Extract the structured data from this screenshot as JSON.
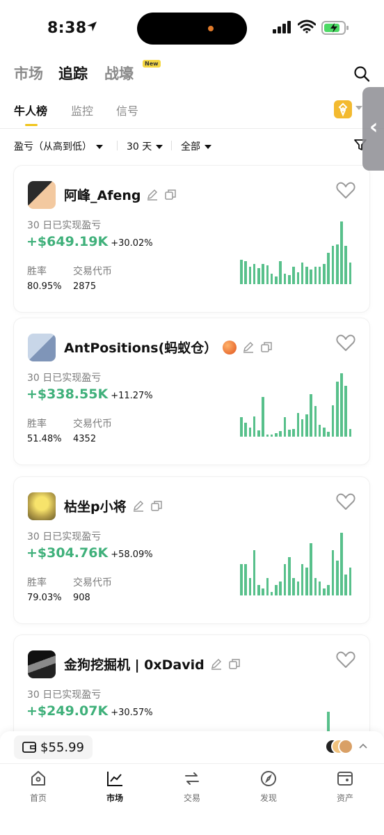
{
  "status_bar": {
    "time": "8:38"
  },
  "top_tabs": {
    "market": "市场",
    "tracking": "追踪",
    "battle": "战壕",
    "new_badge": "New"
  },
  "sub_tabs": {
    "top_traders": "牛人榜",
    "monitor": "监控",
    "signals": "信号"
  },
  "filters": {
    "sort": "盈亏（从高到低）",
    "period": "30 天",
    "scope": "全部"
  },
  "labels": {
    "pnl": "30 日已实现盈亏",
    "win_rate": "胜率",
    "tokens": "交易代币"
  },
  "traders": [
    {
      "name": "阿峰_Afeng",
      "pnl": "+$649.19K",
      "pnl_pct": "+30.02%",
      "win_rate": "80.95%",
      "tokens": "2875",
      "bars": [
        35,
        33,
        25,
        29,
        23,
        29,
        27,
        15,
        11,
        33,
        15,
        13,
        25,
        17,
        31,
        25,
        21,
        25,
        25,
        29,
        45,
        55,
        57,
        90,
        55,
        31
      ]
    },
    {
      "name": "AntPositions(蚂蚁仓）",
      "pnl": "+$338.55K",
      "pnl_pct": "+11.27%",
      "win_rate": "51.48%",
      "tokens": "4352",
      "bars": [
        28,
        20,
        13,
        29,
        9,
        57,
        3,
        3,
        5,
        8,
        28,
        10,
        11,
        34,
        25,
        32,
        61,
        44,
        17,
        13,
        7,
        45,
        79,
        91,
        73,
        11
      ]
    },
    {
      "name": "枯坐p小将",
      "pnl": "+$304.76K",
      "pnl_pct": "+58.09%",
      "win_rate": "79.03%",
      "tokens": "908",
      "bars": [
        45,
        45,
        25,
        65,
        15,
        10,
        25,
        5,
        15,
        20,
        45,
        55,
        25,
        20,
        45,
        40,
        75,
        25,
        20,
        10,
        15,
        65,
        50,
        90,
        30,
        40
      ]
    },
    {
      "name": "金狗挖掘机 | 0xDavid",
      "pnl": "+$249.07K",
      "pnl_pct": "+30.57%",
      "win_rate": "",
      "tokens": "",
      "bars": [
        0,
        0,
        0,
        0,
        0,
        0,
        0,
        0,
        5,
        0,
        0,
        0,
        0,
        0,
        0,
        0,
        0,
        0,
        0,
        0,
        60,
        0,
        0,
        0,
        0,
        0
      ]
    }
  ],
  "wallet": {
    "balance": "$55.99"
  },
  "bottom_nav": [
    {
      "label": "首页",
      "icon": "home-icon"
    },
    {
      "label": "市场",
      "icon": "market-chart-icon"
    },
    {
      "label": "交易",
      "icon": "trade-swap-icon"
    },
    {
      "label": "发现",
      "icon": "discover-compass-icon"
    },
    {
      "label": "资产",
      "icon": "assets-wallet-icon"
    }
  ],
  "colors": {
    "accent": "#f0c419",
    "profit": "#3fb07a",
    "bar": "#58c08b"
  }
}
